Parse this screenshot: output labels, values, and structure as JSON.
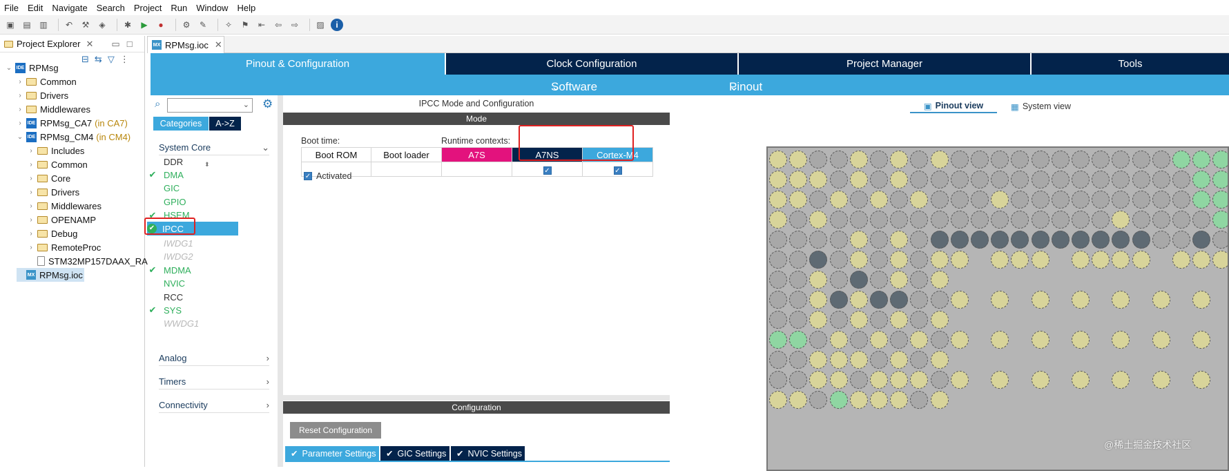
{
  "menu": [
    "File",
    "Edit",
    "Navigate",
    "Search",
    "Project",
    "Run",
    "Window",
    "Help"
  ],
  "explorer": {
    "title": "Project Explorer",
    "items": [
      {
        "label": "RPMsg",
        "indent": 0,
        "icon": "proj",
        "twisty": "down"
      },
      {
        "label": "Common",
        "indent": 1,
        "icon": "folder",
        "twisty": "right"
      },
      {
        "label": "Drivers",
        "indent": 1,
        "icon": "folder",
        "twisty": "right"
      },
      {
        "label": "Middlewares",
        "indent": 1,
        "icon": "folder",
        "twisty": "right"
      },
      {
        "label": "RPMsg_CA7",
        "suffix": "(in CA7)",
        "indent": 1,
        "icon": "proj",
        "twisty": "right"
      },
      {
        "label": "RPMsg_CM4",
        "suffix": "(in CM4)",
        "indent": 1,
        "icon": "proj",
        "twisty": "down"
      },
      {
        "label": "Includes",
        "indent": 2,
        "icon": "folder",
        "twisty": "right"
      },
      {
        "label": "Common",
        "indent": 2,
        "icon": "folder",
        "twisty": "right"
      },
      {
        "label": "Core",
        "indent": 2,
        "icon": "folder",
        "twisty": "right"
      },
      {
        "label": "Drivers",
        "indent": 2,
        "icon": "folder",
        "twisty": "right"
      },
      {
        "label": "Middlewares",
        "indent": 2,
        "icon": "folder",
        "twisty": "right"
      },
      {
        "label": "OPENAMP",
        "indent": 2,
        "icon": "folder",
        "twisty": "right"
      },
      {
        "label": "Debug",
        "indent": 2,
        "icon": "folder",
        "twisty": "right"
      },
      {
        "label": "RemoteProc",
        "indent": 2,
        "icon": "folder",
        "twisty": "right"
      },
      {
        "label": "STM32MP157DAAX_RA",
        "indent": 2,
        "icon": "file",
        "twisty": "none"
      },
      {
        "label": "RPMsg.ioc",
        "indent": 1,
        "icon": "mx",
        "twisty": "none",
        "selected": true
      }
    ]
  },
  "editor_tab": "RPMsg.ioc",
  "top_tabs": [
    "Pinout & Configuration",
    "Clock Configuration",
    "Project Manager",
    "Tools"
  ],
  "sub_tabs": {
    "software_packs": "Software Packs",
    "pinout": "Pinout"
  },
  "categories": {
    "tab_categories": "Categories",
    "tab_az": "A->Z",
    "section_system_core": "System Core",
    "items": [
      {
        "label": "DDR",
        "state": "none"
      },
      {
        "label": "DMA",
        "state": "checked"
      },
      {
        "label": "GIC",
        "state": "green"
      },
      {
        "label": "GPIO",
        "state": "green"
      },
      {
        "label": "HSEM",
        "state": "checked"
      },
      {
        "label": "IPCC",
        "state": "selected"
      },
      {
        "label": "IWDG1",
        "state": "disabled"
      },
      {
        "label": "IWDG2",
        "state": "disabled"
      },
      {
        "label": "MDMA",
        "state": "checked"
      },
      {
        "label": "NVIC",
        "state": "green"
      },
      {
        "label": "RCC",
        "state": "none"
      },
      {
        "label": "SYS",
        "state": "checked"
      },
      {
        "label": "WWDG1",
        "state": "disabled"
      }
    ],
    "section_analog": "Analog",
    "section_timers": "Timers",
    "section_connectivity": "Connectivity"
  },
  "mode_panel": {
    "title": "IPCC Mode and Configuration",
    "mode_header": "Mode",
    "boot_time": "Boot time:",
    "runtime_contexts": "Runtime contexts:",
    "col_boot_rom": "Boot ROM",
    "col_boot_loader": "Boot loader",
    "col_a7s": "A7S",
    "col_a7ns": "A7NS",
    "col_cm4": "Cortex-M4",
    "a7ns_checked": true,
    "cm4_checked": true,
    "activated": "Activated",
    "config_header": "Configuration",
    "reset_button": "Reset Configuration",
    "tabs": [
      "Parameter Settings",
      "GIC Settings",
      "NVIC Settings"
    ]
  },
  "pinout": {
    "pinout_view": "Pinout view",
    "system_view": "System view",
    "watermark": "@稀土掘金技术社区",
    "colors": {
      "grey": "#a8a8a8",
      "yellow": "#d8d49a",
      "green": "#8fd6a2",
      "dark": "#5e6a73",
      "bg": "#b5b5b5"
    }
  }
}
